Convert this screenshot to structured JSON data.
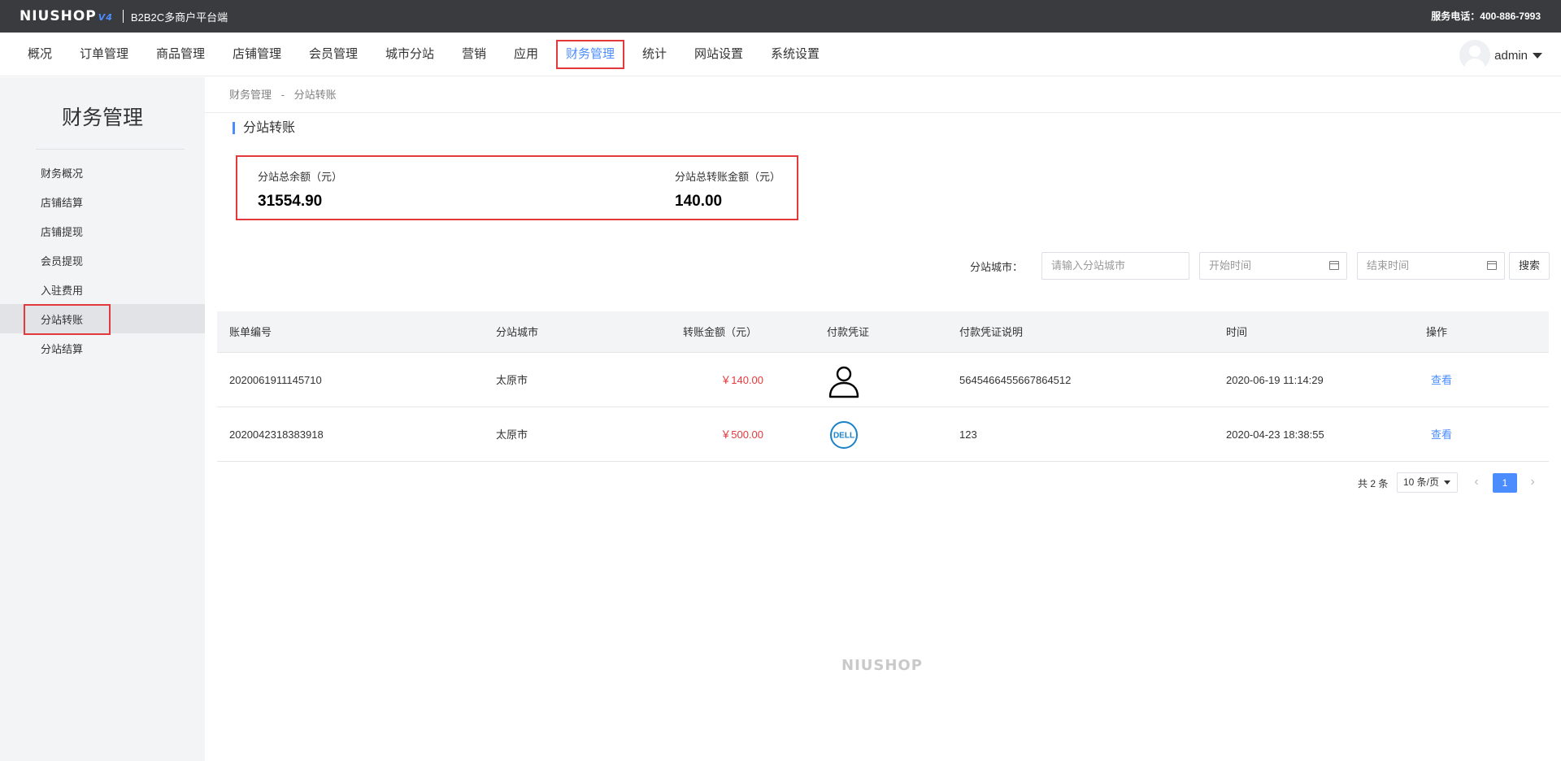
{
  "topbar": {
    "logo_text": "NIUSHOP",
    "logo_version": "V4",
    "platform": "B2B2C多商户平台端",
    "service": "服务电话：400-886-7993"
  },
  "nav": {
    "items": [
      "概况",
      "订单管理",
      "商品管理",
      "店铺管理",
      "会员管理",
      "城市分站",
      "营销",
      "应用",
      "财务管理",
      "统计",
      "网站设置",
      "系统设置"
    ],
    "active": "财务管理",
    "user": "admin"
  },
  "sidebar": {
    "title": "财务管理",
    "items": [
      "财务概况",
      "店铺结算",
      "店铺提现",
      "会员提现",
      "入驻费用",
      "分站转账",
      "分站结算"
    ],
    "active": "分站转账"
  },
  "breadcrumb": [
    "财务管理",
    "-",
    "分站转账"
  ],
  "page_title": "分站转账",
  "summary": {
    "balance_label": "分站总余额（元）",
    "balance_value": "31554.90",
    "transfer_label": "分站总转账金额（元）",
    "transfer_value": "140.00"
  },
  "search": {
    "city_label": "分站城市：",
    "city_placeholder": "请输入分站城市",
    "start_placeholder": "开始时间",
    "end_placeholder": "结束时间",
    "button": "搜索"
  },
  "table": {
    "headers": [
      "账单编号",
      "分站城市",
      "转账金额（元）",
      "付款凭证",
      "付款凭证说明",
      "时间",
      "操作"
    ],
    "rows": [
      {
        "id": "2020061911145710",
        "city": "太原市",
        "amount": "￥140.00",
        "voucher": "user-avatar-icon",
        "desc": "5645466455667864512",
        "time": "2020-06-19 11:14:29",
        "action": "查看"
      },
      {
        "id": "2020042318383918",
        "city": "太原市",
        "amount": "￥500.00",
        "voucher": "dell-logo-icon",
        "desc": "123",
        "time": "2020-04-23 18:38:55",
        "action": "查看"
      }
    ]
  },
  "pagination": {
    "total": "共 2 条",
    "page_size": "10 条/页",
    "current": "1"
  },
  "footer": {
    "logo": "NIUSHOP"
  },
  "colors": {
    "accent": "#4b8cff",
    "danger": "#e4393c",
    "topbar": "#3a3b3f"
  }
}
